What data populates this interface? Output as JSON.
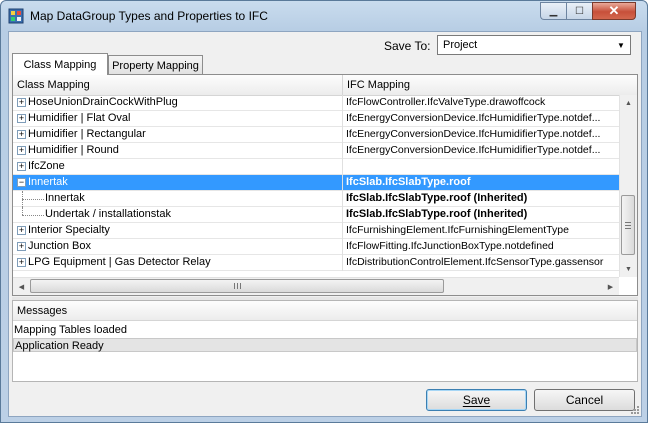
{
  "window": {
    "title": "Map DataGroup Types and Properties to IFC"
  },
  "save_to": {
    "label": "Save To:",
    "value": "Project"
  },
  "tabs": [
    {
      "label": "Class Mapping",
      "active": true
    },
    {
      "label": "Property Mapping",
      "active": false
    }
  ],
  "grid": {
    "columns": [
      "Class Mapping",
      "IFC Mapping"
    ],
    "rows": [
      {
        "label": "HoseUnionDrainCockWithPlug",
        "ifc": "IfcFlowController.IfcValveType.drawoffcock",
        "expander": "+",
        "level": 0
      },
      {
        "label": "Humidifier | Flat Oval",
        "ifc": "IfcEnergyConversionDevice.IfcHumidifierType.notdef...",
        "expander": "+",
        "level": 0
      },
      {
        "label": "Humidifier | Rectangular",
        "ifc": "IfcEnergyConversionDevice.IfcHumidifierType.notdef...",
        "expander": "+",
        "level": 0
      },
      {
        "label": "Humidifier | Round",
        "ifc": "IfcEnergyConversionDevice.IfcHumidifierType.notdef...",
        "expander": "+",
        "level": 0
      },
      {
        "label": "IfcZone",
        "ifc": "",
        "expander": "+",
        "level": 0
      },
      {
        "label": "Innertak",
        "ifc": "IfcSlab.IfcSlabType.roof",
        "expander": "-",
        "level": 0,
        "selected": true
      },
      {
        "label": "Innertak",
        "ifc": "IfcSlab.IfcSlabType.roof (Inherited)",
        "expander": "",
        "level": 1
      },
      {
        "label": "Undertak / installationstak",
        "ifc": "IfcSlab.IfcSlabType.roof (Inherited)",
        "expander": "",
        "level": 1
      },
      {
        "label": "Interior Specialty",
        "ifc": "IfcFurnishingElement.IfcFurnishingElementType",
        "expander": "+",
        "level": 0
      },
      {
        "label": "Junction Box",
        "ifc": "IfcFlowFitting.IfcJunctionBoxType.notdefined",
        "expander": "+",
        "level": 0
      },
      {
        "label": "LPG Equipment | Gas Detector Relay",
        "ifc": "IfcDistributionControlElement.IfcSensorType.gassensor",
        "expander": "+",
        "level": 0
      }
    ]
  },
  "messages": {
    "header": "Messages",
    "lines": [
      "Mapping Tables loaded",
      "Application Ready"
    ]
  },
  "buttons": {
    "save": "Save",
    "cancel": "Cancel"
  },
  "colors": {
    "selection": "#3399ff",
    "titlebar": "#c9dcee",
    "close_button": "#c7503a"
  },
  "icons": {
    "app": "datagroup-app-icon",
    "minimize": "minimize-icon",
    "maximize": "maximize-icon",
    "close": "close-icon"
  }
}
